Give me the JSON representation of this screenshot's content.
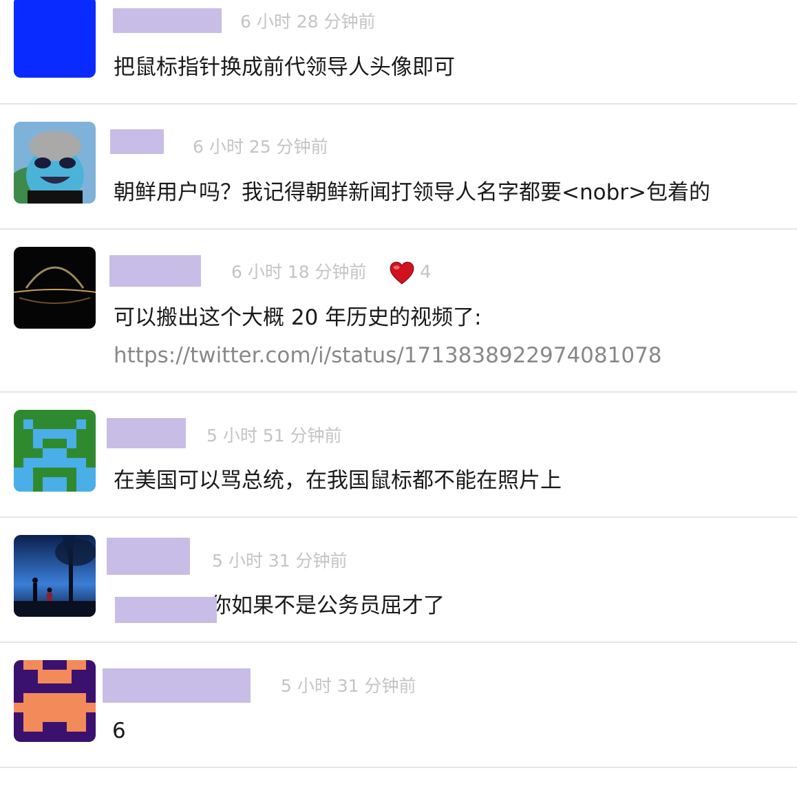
{
  "replies": [
    {
      "time": "6 小时 28 分钟前",
      "content": "把鼠标指针换成前代领导人头像即可"
    },
    {
      "time": "6 小时 25 分钟前",
      "content": "朝鲜用户吗？我记得朝鲜新闻打领导人名字都要<nobr>包着的"
    },
    {
      "time": "6 小时 18 分钟前",
      "content": "可以搬出这个大概 20 年历史的视频了:",
      "link": "https://twitter.com/i/status/1713838922974081078",
      "thanks": "4"
    },
    {
      "time": "5 小时 51 分钟前",
      "content": "在美国可以骂总统，在我国鼠标都不能在照片上"
    },
    {
      "time": "5 小时 31 分钟前",
      "content": "你如果不是公务员屈才了"
    },
    {
      "time": "5 小时 31 分钟前",
      "content": "6"
    }
  ],
  "colors": {
    "username_mask": "#c8bde6",
    "time": "#c4c4c4",
    "link": "#888888",
    "divider": "#e6e6e6"
  },
  "icons": {
    "thanks": "heart-icon"
  }
}
